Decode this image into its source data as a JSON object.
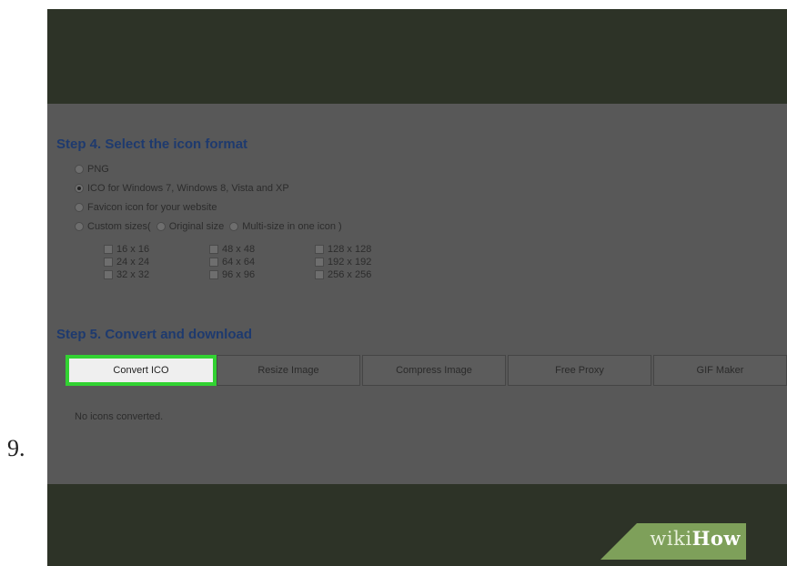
{
  "step_number": "9.",
  "step4": {
    "heading": "Step 4. Select the icon format",
    "options": [
      {
        "label": "PNG",
        "selected": false
      },
      {
        "label": "ICO for Windows 7, Windows 8, Vista and XP",
        "selected": true
      },
      {
        "label": "Favicon icon for your website",
        "selected": false
      }
    ],
    "custom": {
      "label": "Custom sizes(",
      "original_label": "Original size",
      "multi_label": "Multi-size in one icon )",
      "sizes": [
        "16 x 16",
        "24 x 24",
        "32 x 32",
        "48 x 48",
        "64 x 64",
        "96 x 96",
        "128 x 128",
        "192 x 192",
        "256 x 256"
      ]
    }
  },
  "step5": {
    "heading": "Step 5. Convert and download",
    "buttons": [
      "Convert ICO",
      "Resize Image",
      "Compress Image",
      "Free Proxy",
      "GIF Maker"
    ],
    "status": "No icons converted."
  },
  "badge": {
    "wiki": "wiki",
    "how": "How"
  },
  "colors": {
    "dark_band": "#2d3327",
    "overlay": "#585858",
    "heading": "#1e3a6e",
    "highlight": "#32d232",
    "badge": "#7ea05a"
  }
}
